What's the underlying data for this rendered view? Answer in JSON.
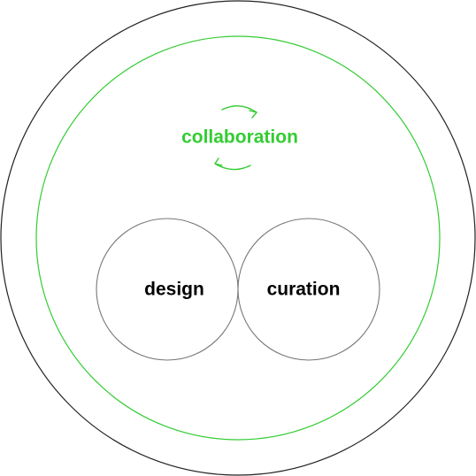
{
  "labels": {
    "collaboration": "collaboration",
    "design": "design",
    "curation": "curation"
  },
  "colors": {
    "outer_ring": "#222222",
    "inner_ring": "#33cc33",
    "venn_circles": "#777777",
    "accent_text": "#33cc33",
    "body_text": "#000000",
    "background": "#ffffff"
  },
  "icons": {
    "cycle_arrows": "cycle-arrows-icon"
  }
}
